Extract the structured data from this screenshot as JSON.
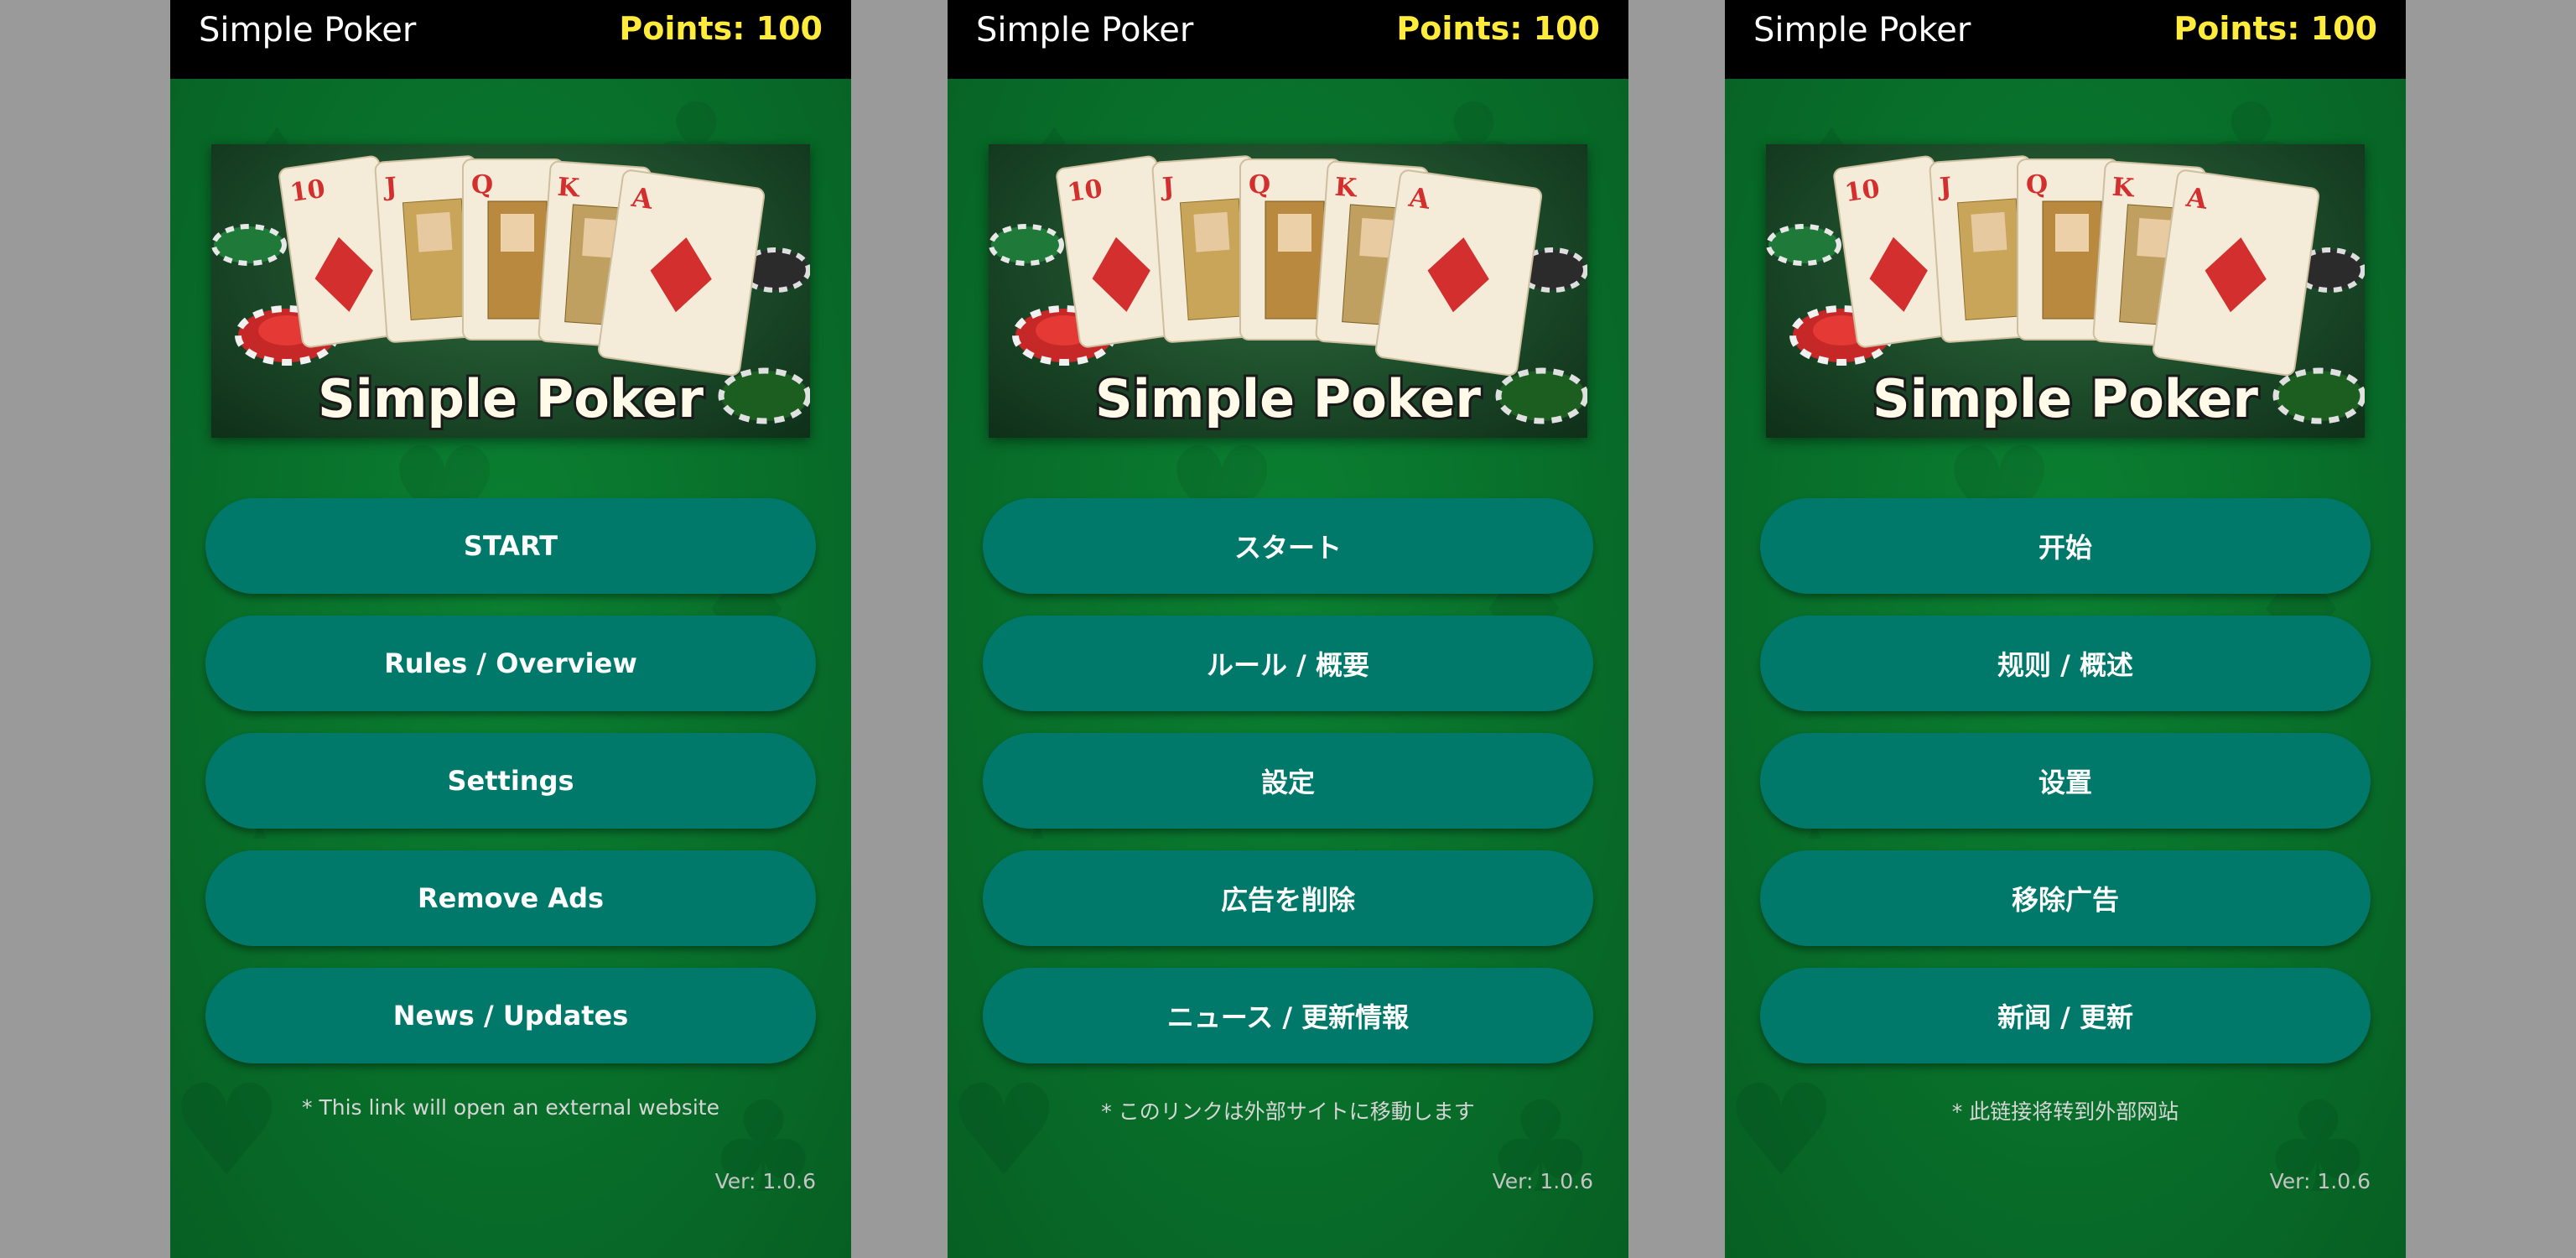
{
  "colors": {
    "points": "#ffeb3b",
    "button": "#00796b",
    "felt": "#086f2a",
    "topbar": "#000000"
  },
  "screens": [
    {
      "lang": "en",
      "app_title": "Simple Poker",
      "points": "Points: 100",
      "banner": {
        "title": "Simple Poker",
        "cards": [
          "10",
          "J",
          "Q",
          "K",
          "A"
        ]
      },
      "buttons": [
        "START",
        "Rules / Overview",
        "Settings",
        "Remove Ads",
        "News / Updates"
      ],
      "note": "* This link will open an external website",
      "version": "Ver: 1.0.6"
    },
    {
      "lang": "ja",
      "app_title": "Simple Poker",
      "points": "Points: 100",
      "banner": {
        "title": "Simple Poker",
        "cards": [
          "10",
          "J",
          "Q",
          "K",
          "A"
        ]
      },
      "buttons": [
        "スタート",
        "ルール / 概要",
        "設定",
        "広告を削除",
        "ニュース / 更新情報"
      ],
      "note": "* このリンクは外部サイトに移動します",
      "version": "Ver: 1.0.6"
    },
    {
      "lang": "zh",
      "app_title": "Simple Poker",
      "points": "Points: 100",
      "banner": {
        "title": "Simple Poker",
        "cards": [
          "10",
          "J",
          "Q",
          "K",
          "A"
        ]
      },
      "buttons": [
        "开始",
        "规则 / 概述",
        "设置",
        "移除广告",
        "新闻 / 更新"
      ],
      "note": "* 此链接将转到外部网站",
      "version": "Ver: 1.0.6"
    }
  ]
}
